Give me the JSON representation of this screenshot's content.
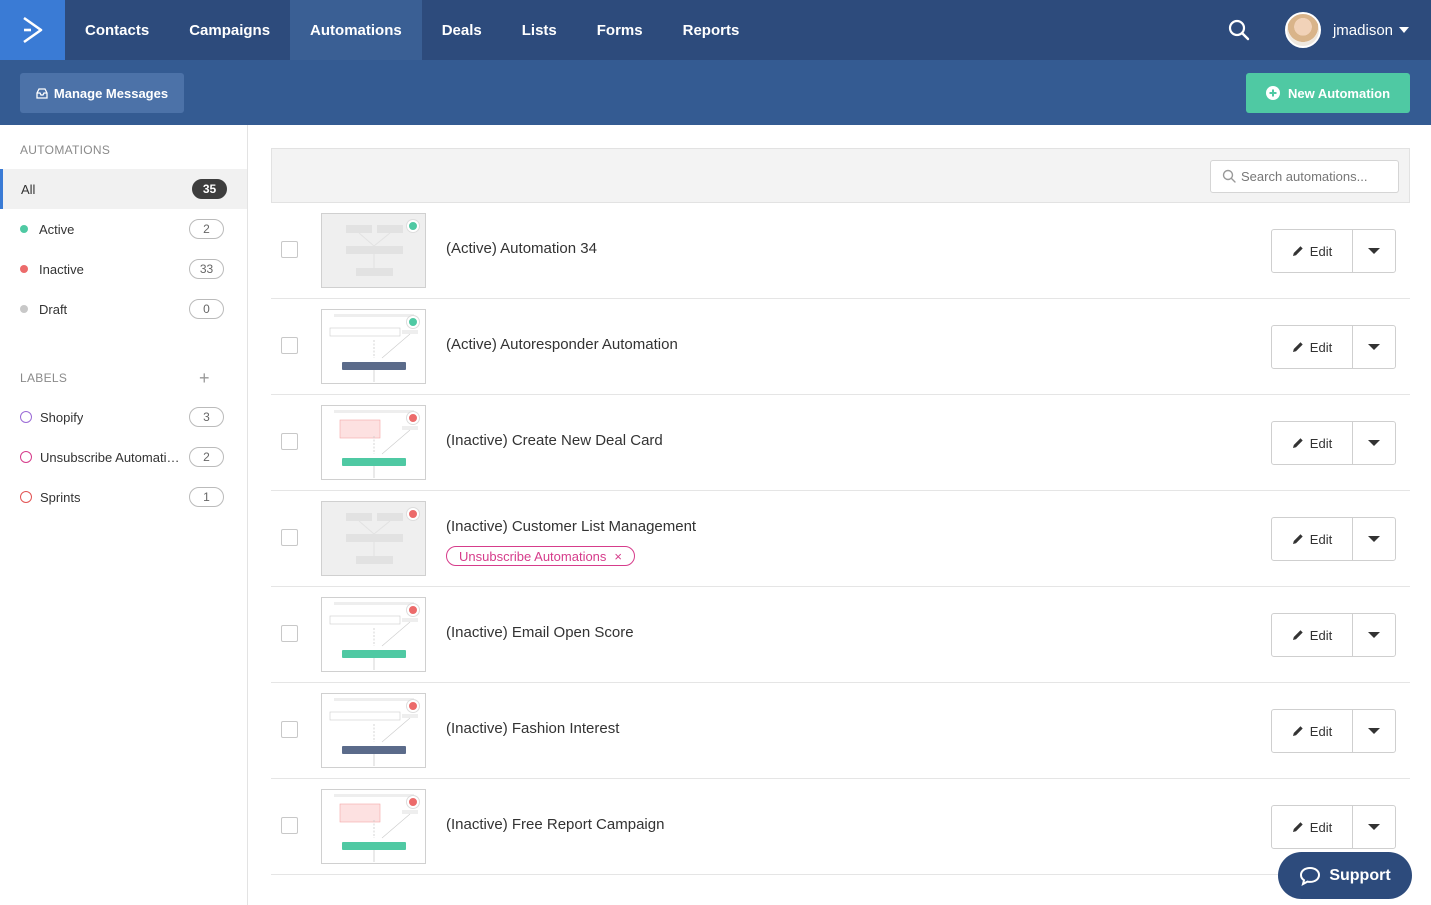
{
  "nav": {
    "items": [
      {
        "label": "Contacts",
        "active": false
      },
      {
        "label": "Campaigns",
        "active": false
      },
      {
        "label": "Automations",
        "active": true
      },
      {
        "label": "Deals",
        "active": false
      },
      {
        "label": "Lists",
        "active": false
      },
      {
        "label": "Forms",
        "active": false
      },
      {
        "label": "Reports",
        "active": false
      }
    ],
    "username": "jmadison"
  },
  "subbar": {
    "manage_label": "Manage Messages",
    "new_label": "New Automation"
  },
  "sidebar": {
    "automations_heading": "AUTOMATIONS",
    "statuses": [
      {
        "label": "All",
        "count": "35"
      },
      {
        "label": "Active",
        "count": "2",
        "color": "#4fc9a3"
      },
      {
        "label": "Inactive",
        "count": "33",
        "color": "#ec6b6b"
      },
      {
        "label": "Draft",
        "count": "0",
        "color": "#c8c8c8"
      }
    ],
    "labels_heading": "LABELS",
    "add_label": "+",
    "labels": [
      {
        "label": "Shopify",
        "count": "3",
        "color": "#9b6bd6"
      },
      {
        "label": "Unsubscribe Automations",
        "count": "2",
        "color": "#d63c8b"
      },
      {
        "label": "Sprints",
        "count": "1",
        "color": "#e25454"
      }
    ]
  },
  "search": {
    "placeholder": "Search automations..."
  },
  "edit_label": "Edit",
  "tag_remove": "×",
  "automations": [
    {
      "name": "(Active) Automation 34",
      "status": "active"
    },
    {
      "name": "(Active) Autoresponder Automation",
      "status": "active"
    },
    {
      "name": "(Inactive) Create New Deal Card",
      "status": "inactive"
    },
    {
      "name": "(Inactive) Customer List Management",
      "status": "inactive",
      "tag": "Unsubscribe Automations"
    },
    {
      "name": "(Inactive) Email Open Score",
      "status": "inactive"
    },
    {
      "name": "(Inactive) Fashion Interest",
      "status": "inactive"
    },
    {
      "name": "(Inactive) Free Report Campaign",
      "status": "inactive"
    }
  ],
  "colors": {
    "active": "#4fc9a3",
    "inactive": "#ec6b6b"
  },
  "support_label": "Support"
}
